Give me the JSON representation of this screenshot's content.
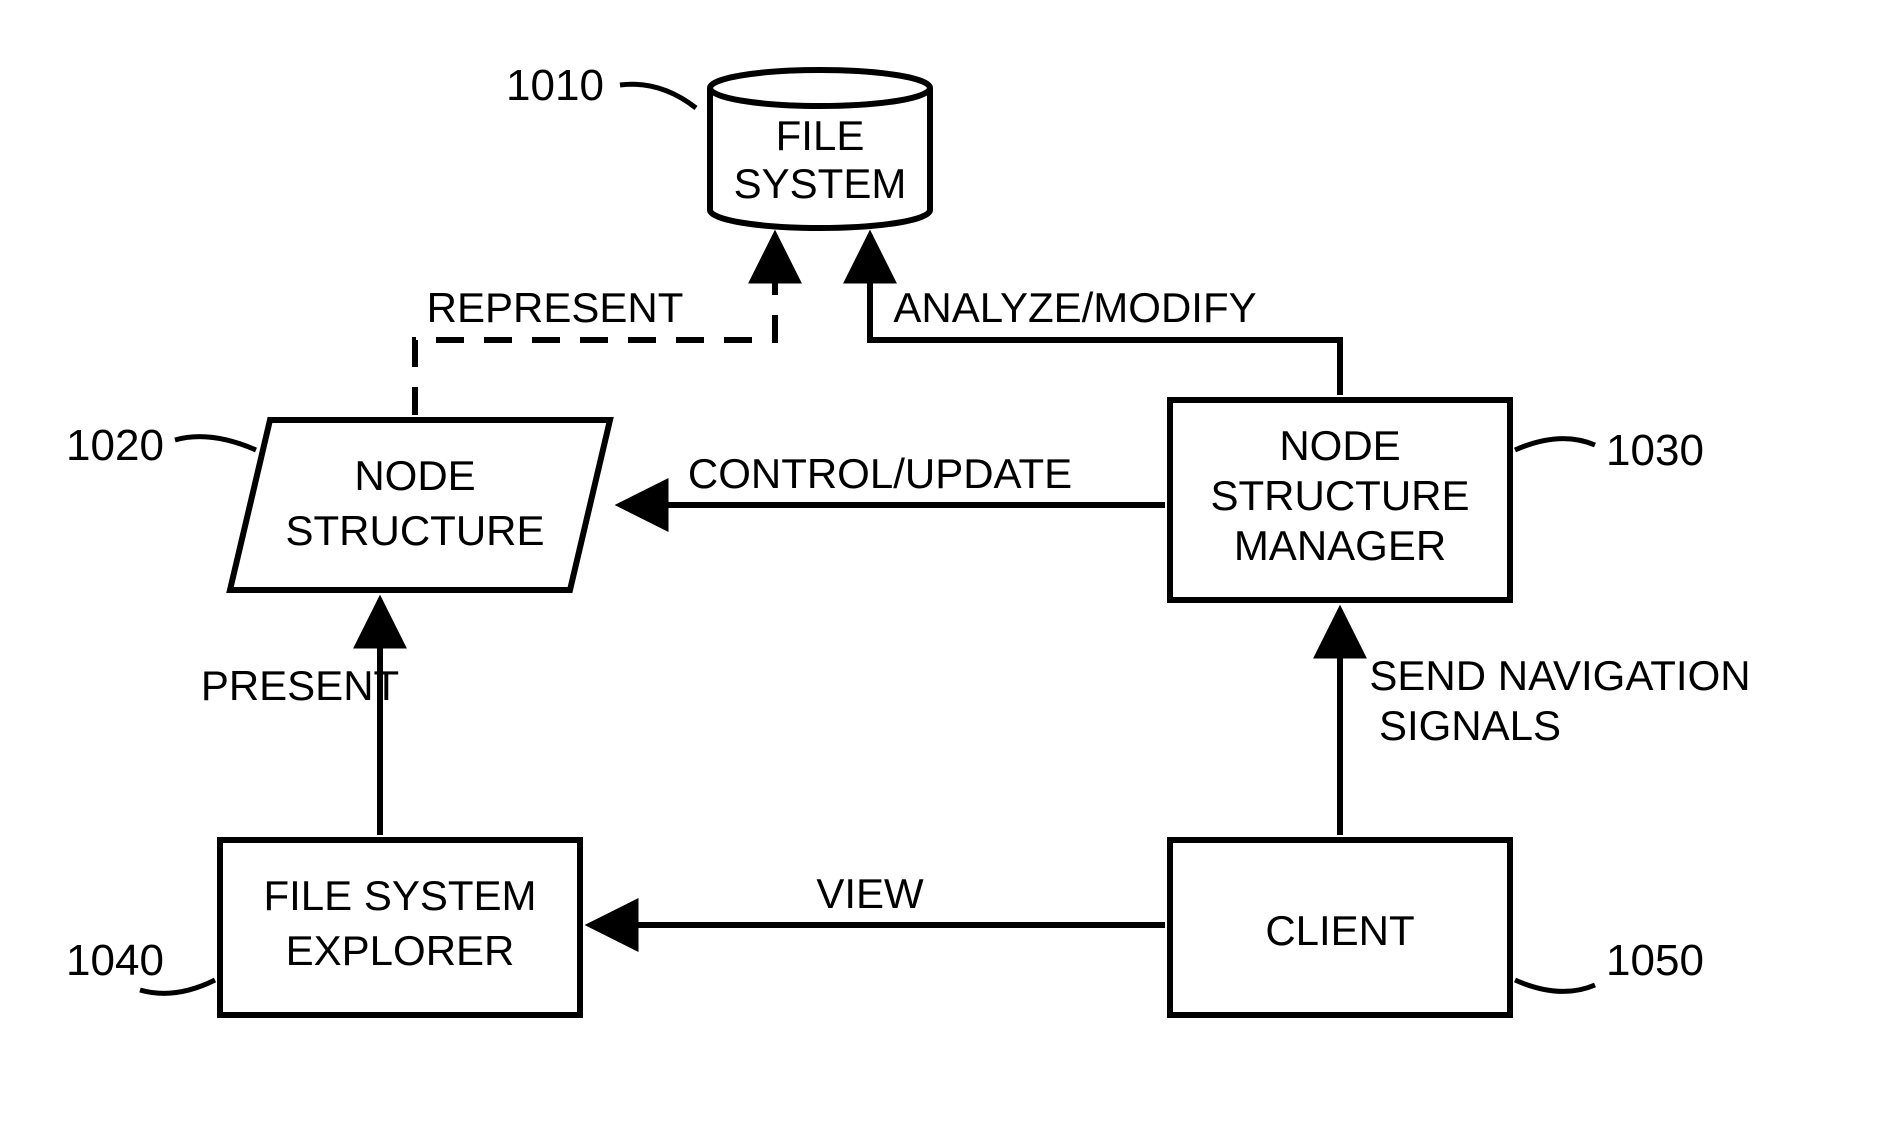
{
  "nodes": {
    "file_system": {
      "ref": "1010",
      "label1": "FILE",
      "label2": "SYSTEM"
    },
    "node_structure": {
      "ref": "1020",
      "label1": "NODE",
      "label2": "STRUCTURE"
    },
    "nsm": {
      "ref": "1030",
      "label1": "NODE",
      "label2": "STRUCTURE",
      "label3": "MANAGER"
    },
    "fse": {
      "ref": "1040",
      "label1": "FILE SYSTEM",
      "label2": "EXPLORER"
    },
    "client": {
      "ref": "1050",
      "label1": "CLIENT"
    }
  },
  "edges": {
    "represent": "REPRESENT",
    "analyze_modify": "ANALYZE/MODIFY",
    "control_update": "CONTROL/UPDATE",
    "present": "PRESENT",
    "view": "VIEW",
    "send_nav1": "SEND NAVIGATION",
    "send_nav2": "SIGNALS"
  }
}
